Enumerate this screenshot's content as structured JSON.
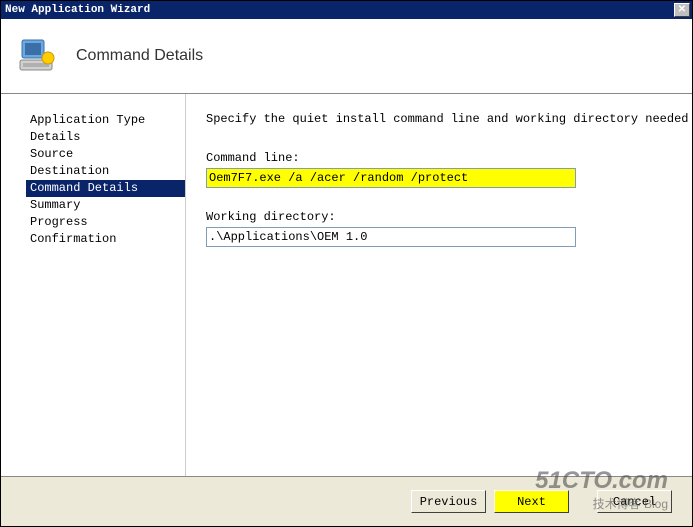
{
  "titlebar": {
    "title": "New Application Wizard",
    "close": "✕"
  },
  "header": {
    "title": "Command Details"
  },
  "sidebar": {
    "items": [
      {
        "label": "Application Type",
        "selected": false
      },
      {
        "label": "Details",
        "selected": false
      },
      {
        "label": "Source",
        "selected": false
      },
      {
        "label": "Destination",
        "selected": false
      },
      {
        "label": "Command Details",
        "selected": true
      },
      {
        "label": "Summary",
        "selected": false
      },
      {
        "label": "Progress",
        "selected": false
      },
      {
        "label": "Confirmation",
        "selected": false
      }
    ]
  },
  "content": {
    "instruction": "Specify the quiet install command line and working directory needed to install this ap",
    "command_line_label": "Command line:",
    "command_line_value": "Oem7F7.exe /a /acer /random /protect",
    "working_dir_label": "Working directory:",
    "working_dir_value": ".\\Applications\\OEM 1.0"
  },
  "footer": {
    "previous": "Previous",
    "next": "Next",
    "cancel": "Cancel"
  },
  "watermark": {
    "line1": "51CTO.com",
    "line2": "技术博客  Blog"
  }
}
